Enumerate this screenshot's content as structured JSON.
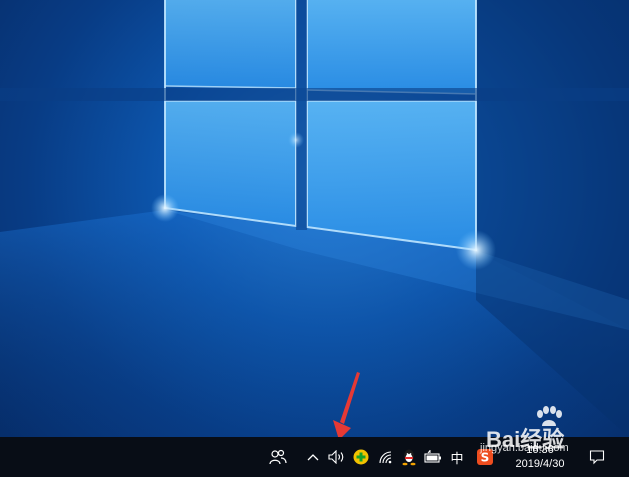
{
  "desktop": {
    "wallpaper": "windows-10-hero",
    "accent_color": "#0f62c4"
  },
  "annotation": {
    "arrow_color": "#e53935",
    "target": "volume-icon"
  },
  "taskbar": {
    "background": "#080d16",
    "tray": {
      "icons": [
        "people-icon",
        "show-hidden-icons-chevron",
        "volume-icon",
        "security-app-icon",
        "wifi-icon",
        "qq-icon",
        "battery-icon",
        "ime-chinese-icon",
        "sogou-input-icon"
      ],
      "ime_label": "中",
      "time": "16:36",
      "date": "2019/4/30"
    },
    "notification_icon": "action-center-icon"
  },
  "watermark": {
    "brand_text": "Bai经验",
    "url_text": "jingyan.baidu.com"
  }
}
